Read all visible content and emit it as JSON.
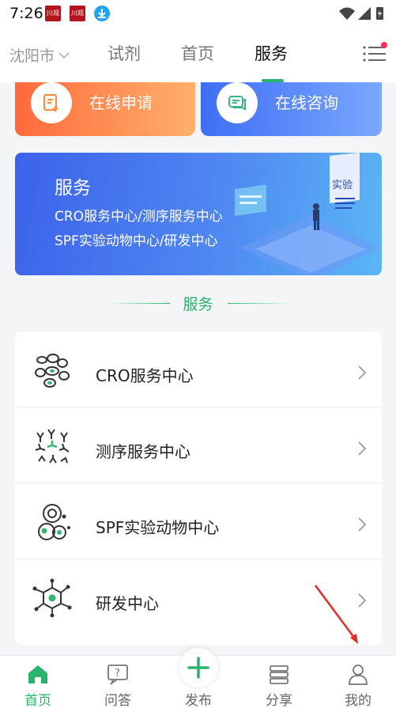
{
  "status_bar": {
    "time": "7:26",
    "app_badge_1": "川观",
    "app_badge_2": "川观"
  },
  "top_nav": {
    "city": "沈阳市",
    "tabs": [
      {
        "label": "试剂"
      },
      {
        "label": "首页"
      },
      {
        "label": "服务"
      }
    ],
    "active_tab": "服务"
  },
  "quick_actions": [
    {
      "label": "在线申请",
      "icon": "apply-form-icon"
    },
    {
      "label": "在线咨询",
      "icon": "chat-icon"
    }
  ],
  "banner": {
    "title": "服务",
    "line1": "CRO服务中心/测序服务中心",
    "line2": "SPF实验动物中心/研发中心",
    "art_label": "实验"
  },
  "section": {
    "title": "服务"
  },
  "services": [
    {
      "label": "CRO服务中心",
      "icon": "cells-icon"
    },
    {
      "label": "测序服务中心",
      "icon": "antibody-icon"
    },
    {
      "label": "SPF实验动物中心",
      "icon": "cell-icon"
    },
    {
      "label": "研发中心",
      "icon": "molecule-icon"
    }
  ],
  "bottom_nav": {
    "items": [
      {
        "label": "首页",
        "icon": "home-icon"
      },
      {
        "label": "问答",
        "icon": "qa-icon"
      },
      {
        "label": "发布",
        "icon": "plus-icon"
      },
      {
        "label": "分享",
        "icon": "share-icon"
      },
      {
        "label": "我的",
        "icon": "user-icon"
      }
    ],
    "active": "首页"
  },
  "colors": {
    "accent": "#28b46c",
    "orange_start": "#ff6a3d",
    "blue_start": "#3f6ef5",
    "annotation": "#e62a2a"
  }
}
